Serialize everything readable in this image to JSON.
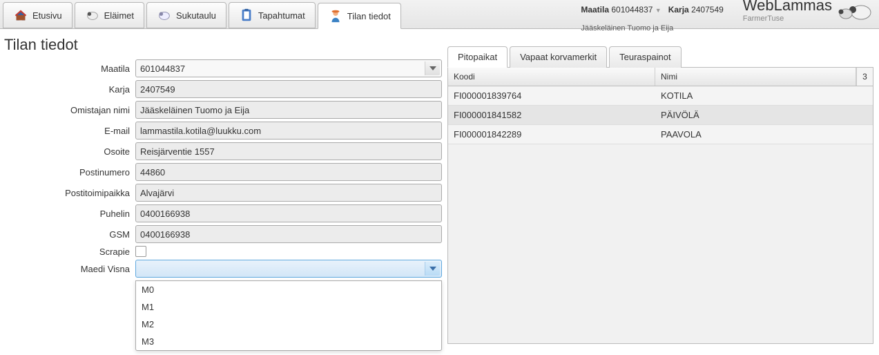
{
  "nav": {
    "tabs": [
      {
        "label": "Etusivu"
      },
      {
        "label": "Eläimet"
      },
      {
        "label": "Sukutaulu"
      },
      {
        "label": "Tapahtumat"
      },
      {
        "label": "Tilan tiedot"
      }
    ]
  },
  "header": {
    "maatila_label": "Maatila",
    "maatila_value": "601044837",
    "karja_label": "Karja",
    "karja_value": "2407549",
    "user": "Jääskeläinen Tuomo ja Eija",
    "brand": "WebLammas",
    "brand_sub": "FarmerTuse"
  },
  "page_title": "Tilan tiedot",
  "form": {
    "maatila": {
      "label": "Maatila",
      "value": "601044837"
    },
    "karja": {
      "label": "Karja",
      "value": "2407549"
    },
    "omistaja": {
      "label": "Omistajan nimi",
      "value": "Jääskeläinen Tuomo ja Eija"
    },
    "email": {
      "label": "E-mail",
      "value": "lammastila.kotila@luukku.com"
    },
    "osoite": {
      "label": "Osoite",
      "value": "Reisjärventie 1557"
    },
    "postinumero": {
      "label": "Postinumero",
      "value": "44860"
    },
    "postitoimipaikka": {
      "label": "Postitoimipaikka",
      "value": "Alvajärvi"
    },
    "puhelin": {
      "label": "Puhelin",
      "value": "0400166938"
    },
    "gsm": {
      "label": "GSM",
      "value": "0400166938"
    },
    "scrapie": {
      "label": "Scrapie"
    },
    "maedi": {
      "label": "Maedi Visna",
      "value": "",
      "options": [
        "M0",
        "M1",
        "M2",
        "M3"
      ]
    }
  },
  "right": {
    "tabs": [
      "Pitopaikat",
      "Vapaat korvamerkit",
      "Teuraspainot"
    ],
    "grid": {
      "head": {
        "koodi": "Koodi",
        "nimi": "Nimi",
        "count": "3"
      },
      "rows": [
        {
          "koodi": "FI000001839764",
          "nimi": "KOTILA"
        },
        {
          "koodi": "FI000001841582",
          "nimi": "PÄIVÖLÄ"
        },
        {
          "koodi": "FI000001842289",
          "nimi": "PAAVOLA"
        }
      ]
    }
  }
}
